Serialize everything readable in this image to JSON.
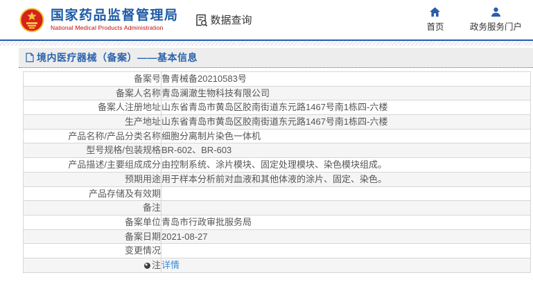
{
  "header": {
    "logo": {
      "title": "国家药品监督管理局",
      "subtitle": "National Medical Products Administration",
      "emblem_icon": "china-national-emblem"
    },
    "data_query": {
      "label": "数据查询",
      "icon": "document-search-icon"
    },
    "nav": [
      {
        "label": "首页",
        "icon": "home-icon"
      },
      {
        "label": "政务服务门户",
        "icon": "user-icon"
      }
    ]
  },
  "section": {
    "title": "境内医疗器械（备案）——基本信息",
    "icon": "document-icon"
  },
  "table": {
    "rows": [
      {
        "label": "备案号",
        "value": "鲁青械备20210583号"
      },
      {
        "label": "备案人名称",
        "value": "青岛澜澈生物科技有限公司"
      },
      {
        "label": "备案人注册地址",
        "value": "山东省青岛市黄岛区胶南街道东元路1467号南1栋四-六楼"
      },
      {
        "label": "生产地址",
        "value": "山东省青岛市黄岛区胶南街道东元路1467号南1栋四-六楼"
      },
      {
        "label": "产品名称/产品分类名称",
        "value": "细胞分离制片染色一体机"
      },
      {
        "label": "型号规格/包装规格",
        "value": "BR-602、BR-603"
      },
      {
        "label": "产品描述/主要组成成分",
        "value": "由控制系统、涂片模块、固定处理模块、染色模块组成。"
      },
      {
        "label": "预期用途",
        "value": "用于样本分析前对血液和其他体液的涂片、固定、染色。"
      },
      {
        "label": "产品存储及有效期",
        "value": ""
      },
      {
        "label": "备注",
        "value": ""
      },
      {
        "label": "备案单位",
        "value": "青岛市行政审批服务局"
      },
      {
        "label": "备案日期",
        "value": "2021-08-27"
      },
      {
        "label": "变更情况",
        "value": ""
      },
      {
        "label": "注",
        "value": "详情",
        "note_icon": "note-dot-icon"
      }
    ]
  },
  "colors": {
    "brand_blue": "#1e5aa5",
    "subtitle_red": "#c30000",
    "nav_icon_blue": "#2a5cae",
    "header_line_blue": "#1c5fae",
    "section_title_blue": "#2a63ad",
    "link_blue": "#3b8ad8",
    "alt_row_bg": "#f5f5f5"
  }
}
